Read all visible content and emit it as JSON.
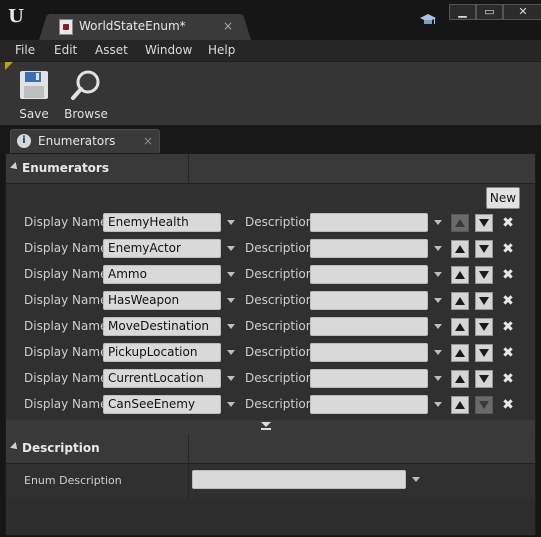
{
  "window": {
    "tab_title": "WorldStateEnum*",
    "tab_close": "×",
    "minimize": "▁",
    "maximize": "▭",
    "close": "✕"
  },
  "menu": [
    "File",
    "Edit",
    "Asset",
    "Window",
    "Help"
  ],
  "toolbar": {
    "save_label": "Save",
    "browse_label": "Browse"
  },
  "panel_tab": {
    "label": "Enumerators",
    "close": "×"
  },
  "enumerators": {
    "section_title": "Enumerators",
    "new_label": "New",
    "display_name_label": "Display Name",
    "description_label": "Description",
    "rows": [
      {
        "display_name": "EnemyHealth",
        "description": "",
        "up_enabled": false,
        "down_enabled": true
      },
      {
        "display_name": "EnemyActor",
        "description": "",
        "up_enabled": true,
        "down_enabled": true
      },
      {
        "display_name": "Ammo",
        "description": "",
        "up_enabled": true,
        "down_enabled": true
      },
      {
        "display_name": "HasWeapon",
        "description": "",
        "up_enabled": true,
        "down_enabled": true
      },
      {
        "display_name": "MoveDestination",
        "description": "",
        "up_enabled": true,
        "down_enabled": true
      },
      {
        "display_name": "PickupLocation",
        "description": "",
        "up_enabled": true,
        "down_enabled": true
      },
      {
        "display_name": "CurrentLocation",
        "description": "",
        "up_enabled": true,
        "down_enabled": true
      },
      {
        "display_name": "CanSeeEnemy",
        "description": "",
        "up_enabled": true,
        "down_enabled": false
      }
    ]
  },
  "description_section": {
    "section_title": "Description",
    "field_label": "Enum Description",
    "field_value": ""
  },
  "icons": {
    "logo": "unreal-logo-icon",
    "save": "floppy-disk-icon",
    "browse": "magnifier-icon",
    "details": "info-icon",
    "grad_cap": "graduation-cap-icon"
  },
  "colors": {
    "background": "#161616",
    "panel": "#303030",
    "field": "#d9d9d9",
    "accent": "#c9a100"
  }
}
